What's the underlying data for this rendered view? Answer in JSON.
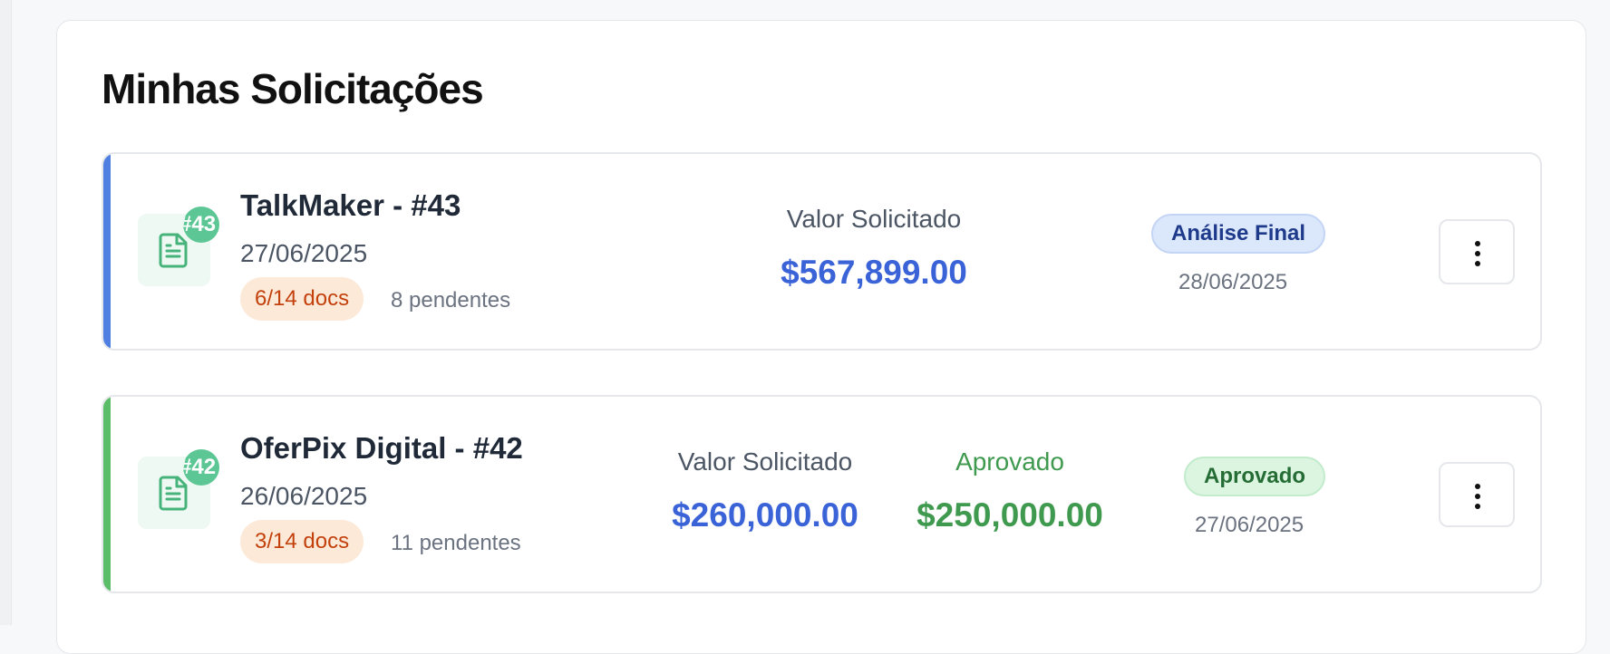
{
  "panel": {
    "title": "Minhas Solicitações"
  },
  "requests": [
    {
      "title": "TalkMaker - #43",
      "badge": "#43",
      "date": "27/06/2025",
      "docs": "6/14 docs",
      "pending": "8 pendentes",
      "requested_label": "Valor Solicitado",
      "requested_value": "$567,899.00",
      "status": "Análise Final",
      "status_date": "28/06/2025",
      "accent_color": "#4f7fe0"
    },
    {
      "title": "OferPix Digital - #42",
      "badge": "#42",
      "date": "26/06/2025",
      "docs": "3/14 docs",
      "pending": "11 pendentes",
      "requested_label": "Valor Solicitado",
      "requested_value": "$260,000.00",
      "approved_label": "Aprovado",
      "approved_value": "$250,000.00",
      "status": "Aprovado",
      "status_date": "27/06/2025",
      "accent_color": "#5cbd68"
    }
  ],
  "icons": {
    "document": "document-icon",
    "more": "more-vertical-icon"
  }
}
